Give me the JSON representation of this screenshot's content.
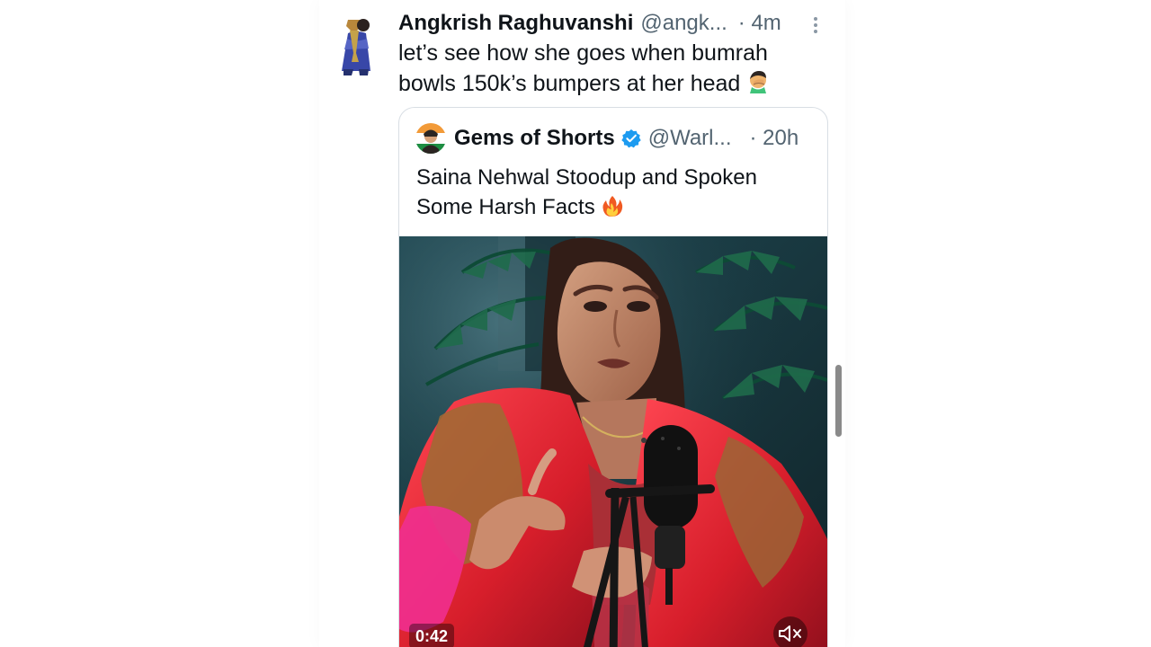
{
  "tweet": {
    "author_name": "Angkrish Raghuvanshi",
    "author_handle": "@angk...",
    "time": "· 4m",
    "text": "let’s see how she goes when bumrah bowls 150k’s bumpers at her head",
    "emoji": "face-palm-emoji",
    "more_icon": "more-options-icon"
  },
  "quoted": {
    "author_name": "Gems of Shorts",
    "author_handle": "@Warl...",
    "time": "· 20h",
    "verified_icon": "verified-badge-icon",
    "text": "Saina Nehwal Stoodup and Spoken Some Harsh Facts",
    "emoji": "fire-emoji",
    "video": {
      "duration": "0:42",
      "mute_icon": "volume-muted-icon"
    }
  },
  "colors": {
    "text": "#0f1419",
    "secondary": "#536471",
    "verified": "#1d9bf0",
    "border": "#d8dee4"
  }
}
